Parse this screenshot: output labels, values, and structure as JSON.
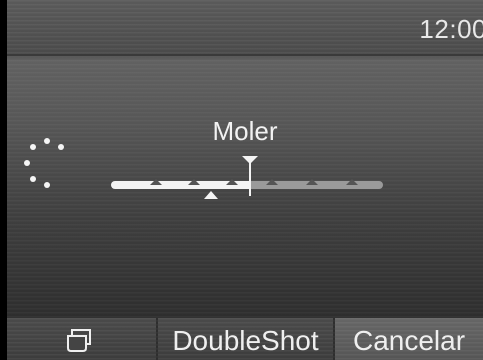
{
  "status": {
    "time": "12:00"
  },
  "main": {
    "title": "Moler",
    "grind_level": {
      "min": 1,
      "max": 7,
      "current": 4,
      "selected": 4
    }
  },
  "softkeys": [
    {
      "icon": "cup-icon",
      "label": ""
    },
    {
      "label": "DoubleShot"
    },
    {
      "label": "Cancelar"
    }
  ]
}
